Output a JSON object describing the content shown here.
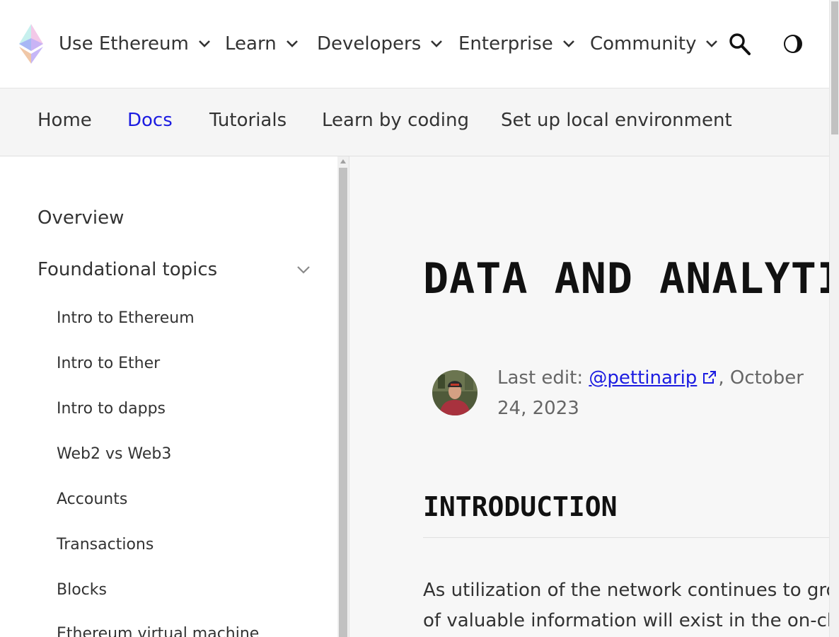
{
  "header": {
    "nav": [
      {
        "label": "Use Ethereum"
      },
      {
        "label": "Learn"
      },
      {
        "label": "Developers"
      },
      {
        "label": "Enterprise"
      },
      {
        "label": "Community"
      }
    ]
  },
  "subnav": {
    "items": [
      {
        "label": "Home"
      },
      {
        "label": "Docs"
      },
      {
        "label": "Tutorials"
      },
      {
        "label": "Learn by coding"
      },
      {
        "label": "Set up local environment"
      }
    ],
    "active": "Docs"
  },
  "sidebar": {
    "overview": "Overview",
    "foundational": "Foundational topics",
    "items": [
      "Intro to Ethereum",
      "Intro to Ether",
      "Intro to dapps",
      "Web2 vs Web3",
      "Accounts",
      "Transactions",
      "Blocks",
      "Ethereum virtual machine"
    ]
  },
  "main": {
    "title": "DATA AND ANALYTICS",
    "last_edit_prefix": "Last edit: ",
    "author": "@pettinarip",
    "date_suffix": ", October 24, 2023",
    "intro_heading": "INTRODUCTION",
    "intro_line1": "As utilization of the network continues to grow,",
    "intro_line2": "of valuable information will exist in the on-chain"
  },
  "colors": {
    "link": "#1c1ce1",
    "text": "#333333",
    "muted": "#666666"
  }
}
